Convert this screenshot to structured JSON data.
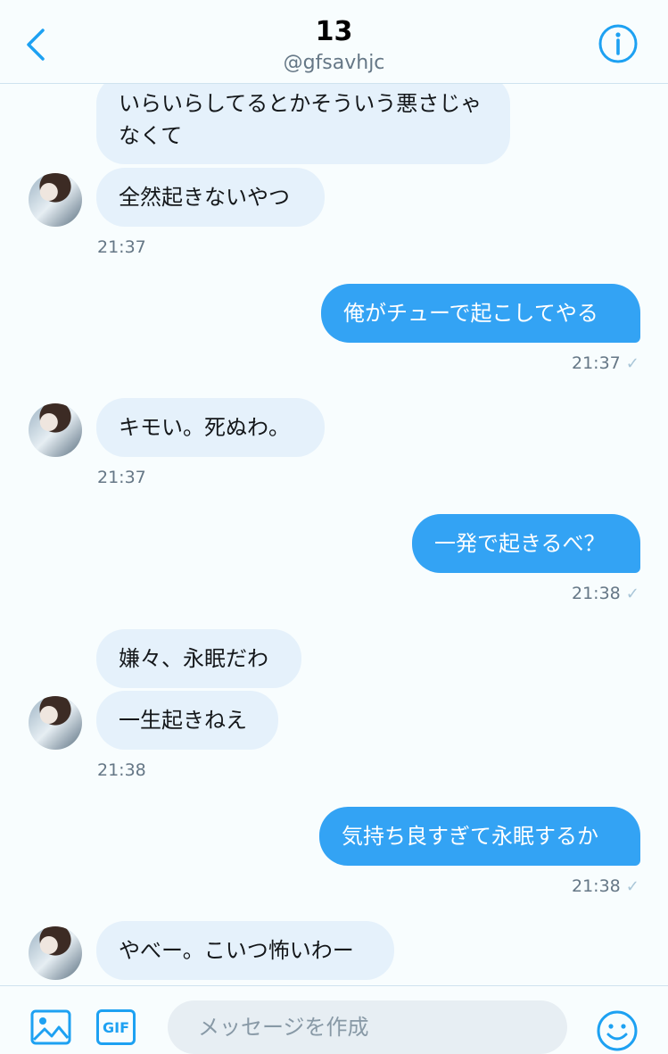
{
  "header": {
    "title": "13",
    "handle": "@gfsavhjc"
  },
  "messages": [
    {
      "dir": "in",
      "text": "いらいらしてるとかそういう悪さじゃなくて"
    },
    {
      "dir": "in",
      "text": "全然起きないやつ"
    },
    {
      "dir": "in_time",
      "text": "21:37"
    },
    {
      "dir": "out",
      "text": "俺がチューで起こしてやる"
    },
    {
      "dir": "out_time",
      "text": "21:37"
    },
    {
      "dir": "in",
      "text": "キモい。死ぬわ。"
    },
    {
      "dir": "in_time",
      "text": "21:37"
    },
    {
      "dir": "out",
      "text": "一発で起きるべ？"
    },
    {
      "dir": "out_time",
      "text": "21:38"
    },
    {
      "dir": "in",
      "text": "嫌々、永眠だわ"
    },
    {
      "dir": "in",
      "text": "一生起きねえ"
    },
    {
      "dir": "in_time",
      "text": "21:38"
    },
    {
      "dir": "out",
      "text": "気持ち良すぎて永眠するか"
    },
    {
      "dir": "out_time",
      "text": "21:38"
    },
    {
      "dir": "in",
      "text": "やべー。こいつ怖いわー"
    }
  ],
  "read_mark": "✓",
  "composer": {
    "placeholder": "メッセージを作成",
    "gif_label": "GIF"
  },
  "icons": {
    "back": "chevron-left-icon",
    "info": "info-icon",
    "image": "image-icon",
    "emoji": "emoji-icon"
  },
  "colors": {
    "accent": "#1da1f2",
    "outgoing_bubble": "#33a3f4",
    "incoming_bubble": "#e5f1fb"
  }
}
